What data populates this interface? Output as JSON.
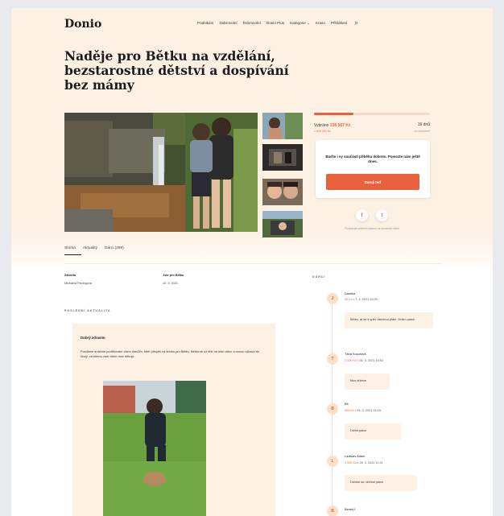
{
  "header": {
    "logo": "Donio",
    "nav": [
      "Podnikání",
      "Dobrovolní",
      "Dobrovolní",
      "Donio Plus",
      "Kategorie ⌄",
      "Kraso",
      "Přihlášení"
    ]
  },
  "campaign": {
    "title": "Naděje pro Bětku na vzdělání, bezstarostné dětství a dospívání bez mámy"
  },
  "donation": {
    "progress": 0.34,
    "raised_label": "Vybráno",
    "raised_amount": "238 567 Kč",
    "raised_sub": "z 600 000 Kč",
    "days_label": "19 dnů",
    "days_sub": "do ukončení",
    "cta_text": "Buďte i vy součástí příběhu dobrem. Pomozte nám ještě dnes.",
    "cta_button": "Daruji teď",
    "share_facebook": "f",
    "share_twitter": "t",
    "share_note": "Podporujte sdílením odkazu na sociálních sítích"
  },
  "tabs": [
    "Sbírka",
    "Aktuality",
    "Dárci (299)"
  ],
  "details": {
    "founder_label": "Založila",
    "founder_value": "Michaela Pecingová",
    "date_label": "Jste pro Bětku",
    "date_value": "10. 3. 2021",
    "latest_update_label": "POSLEDNÍ AKTUALITA"
  },
  "update": {
    "title": "Dobrý zdravím",
    "text": "Posíláme srdečné poděkování všem dárcům, kteří přispěli na sbírku pro Bětku. Bětka se už těší na letní tábor a novou výbavu do školy, za kterou vám všem moc děkuje."
  },
  "donors_heading": "DÁRCI",
  "donors": [
    {
      "initial": "J",
      "name": "Daniela",
      "amount": "50 Kč",
      "date": "7. 4. 2021 10:25",
      "message": "Bětko, ať se ti splní všechna přání. Držím palce."
    },
    {
      "initial": "T",
      "name": "Tána Kocurová",
      "amount": "2 000 Kč",
      "date": "31. 3. 2021 15:52",
      "message": "Moc držíme"
    },
    {
      "initial": "B",
      "name": "Bit",
      "amount": "500 Kč",
      "date": "26. 3. 2021 14:24",
      "message": "Držím palce"
    },
    {
      "initial": "L",
      "name": "Ladislav Adam",
      "amount": "1 000 Kč",
      "date": "26. 3. 2021 11:31",
      "message": "Držíme se, držíme palce"
    },
    {
      "initial": "B",
      "name": "Beneš I."
    }
  ],
  "colors": {
    "accent": "#e8613c",
    "hero_background": "#fdf1e4"
  }
}
